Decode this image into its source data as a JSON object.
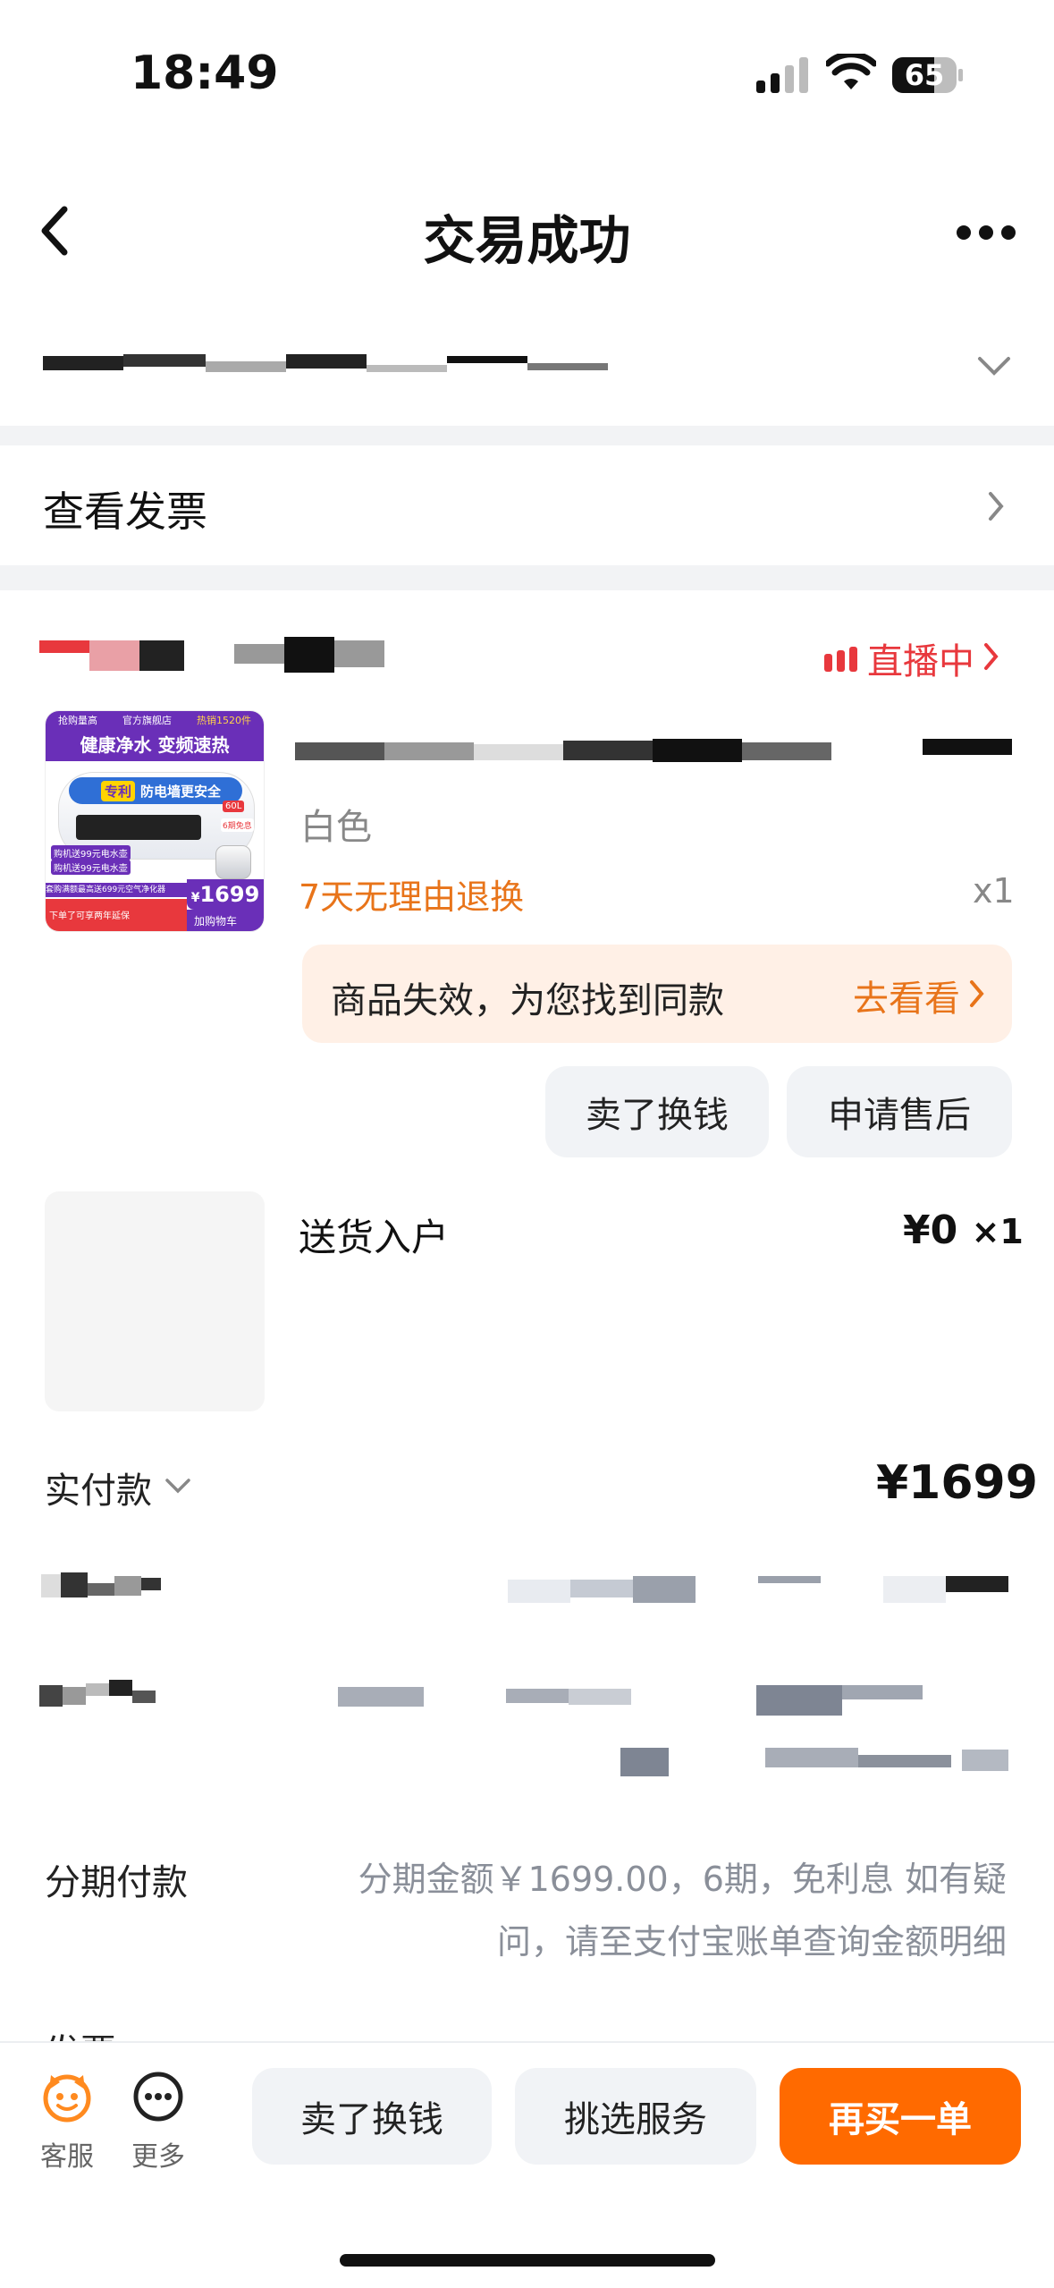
{
  "status_bar": {
    "time": "18:49",
    "battery": "65"
  },
  "nav": {
    "title": "交易成功"
  },
  "invoice_row": {
    "label": "查看发票"
  },
  "shop": {
    "live_label": "直播中"
  },
  "product": {
    "thumb_texts": {
      "tag1": "抢购量高",
      "tag2": "官方旗舰店",
      "tag3": "热销1520件",
      "headline": "健康净水 变频速热",
      "patent": "专利",
      "patent_desc": "防电墙更安全",
      "price": "1699",
      "link": "加购物车",
      "mini1": "购机送99元电水壶",
      "mini2": "购机送99元电水壶",
      "mini3": "套购满额最高送699元空气净化器",
      "mini4": "下单了可享两年延保",
      "mini5": "60L",
      "mini6": "6期免息"
    },
    "spec": "白色",
    "return_policy": "7天无理由退换",
    "qty": "x1",
    "notice": "商品失效，为您找到同款",
    "notice_link": "去看看",
    "btn_sell": "卖了换钱",
    "btn_after_sale": "申请售后"
  },
  "service": {
    "name": "送货入户",
    "price": "¥0",
    "qty": "×1"
  },
  "paid": {
    "label": "实付款",
    "amount": "¥1699"
  },
  "installment": {
    "label": "分期付款",
    "value_line1": "分期金额￥1699.00，6期，免利息 如有疑",
    "value_line2": "问，请至支付宝账单查询金额明细"
  },
  "partial_row": {
    "label": "发票"
  },
  "bottom": {
    "service_label": "客服",
    "more_label": "更多",
    "btn1": "卖了换钱",
    "btn2": "挑选服务",
    "btn3": "再买一单"
  },
  "colors": {
    "accent": "#ff6a00",
    "live_red": "#e8383d",
    "orange_text": "#e8741a",
    "notice_bg": "#fff0e6"
  }
}
